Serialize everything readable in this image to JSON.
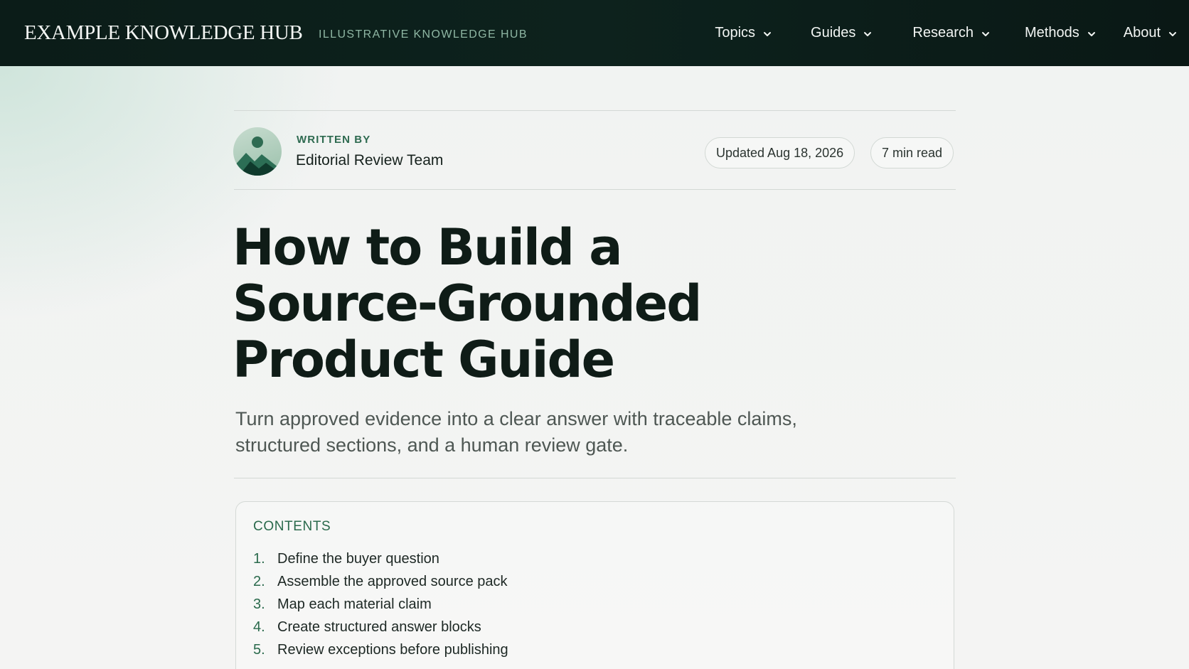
{
  "header": {
    "brand": "EXAMPLE KNOWLEDGE HUB",
    "tagline": "ILLUSTRATIVE KNOWLEDGE HUB",
    "nav": [
      {
        "label": "Topics",
        "icon": "chevron-down-icon"
      },
      {
        "label": "Guides",
        "icon": "chevron-down-icon"
      },
      {
        "label": "Research",
        "icon": "chevron-down-icon"
      },
      {
        "label": "Methods",
        "icon": "chevron-down-icon"
      },
      {
        "label": "About",
        "icon": "chevron-down-icon"
      }
    ]
  },
  "byline": {
    "written_by_label": "WRITTEN BY",
    "author": "Editorial Review Team",
    "avatar_icon": "mountain-person-avatar-icon",
    "updated": "Updated Aug 18, 2026",
    "read_time": "7 min read"
  },
  "article": {
    "title_lines": [
      "How to Build a",
      "Source-Grounded",
      "Product Guide"
    ],
    "subtitle_lines": [
      "Turn approved evidence into a clear answer with traceable claims,",
      "structured sections, and a human review gate."
    ]
  },
  "contents": {
    "heading": "CONTENTS",
    "items": [
      {
        "num": "1.",
        "label": "Define the buyer question"
      },
      {
        "num": "2.",
        "label": "Assemble the approved source pack"
      },
      {
        "num": "3.",
        "label": "Map each material claim"
      },
      {
        "num": "4.",
        "label": "Create structured answer blocks"
      },
      {
        "num": "5.",
        "label": "Review exceptions before publishing"
      }
    ]
  },
  "colors": {
    "header_bg": "#0b1c18",
    "accent_green": "#2a6a4c",
    "tagline_green": "#8fb7a4"
  }
}
